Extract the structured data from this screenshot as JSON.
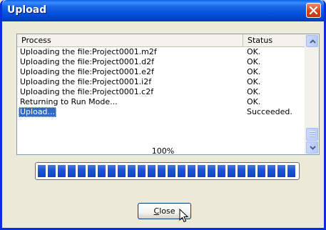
{
  "window": {
    "title": "Upload"
  },
  "list": {
    "columns": [
      "Process",
      "Status"
    ],
    "rows": [
      {
        "process": "Uploading the file:Project0001.m2f",
        "status": "OK."
      },
      {
        "process": "Uploading the file:Project0001.d2f",
        "status": "OK."
      },
      {
        "process": "Uploading the file:Project0001.e2f",
        "status": "OK."
      },
      {
        "process": "Uploading the file:Project0001.i2f",
        "status": "OK."
      },
      {
        "process": "Uploading the file:Project0001.c2f",
        "status": "OK."
      },
      {
        "process": "Returning to Run Mode...",
        "status": "OK."
      },
      {
        "process": "Upload...",
        "status": "Succeeded.",
        "selected": true
      }
    ]
  },
  "progress": {
    "label": "100%",
    "value": 1.0
  },
  "buttons": {
    "close_mnemonic": "C",
    "close_rest": "lose"
  },
  "icons": {
    "close": "close-icon",
    "scroll_up": "chevron-up-icon",
    "scroll_down": "chevron-down-icon",
    "cursor": "mouse-pointer-icon"
  },
  "colors": {
    "titlebar": "#0553DE",
    "selection": "#316AC5",
    "progress_fill": "#1E55D8",
    "close_button": "#D1451A"
  }
}
